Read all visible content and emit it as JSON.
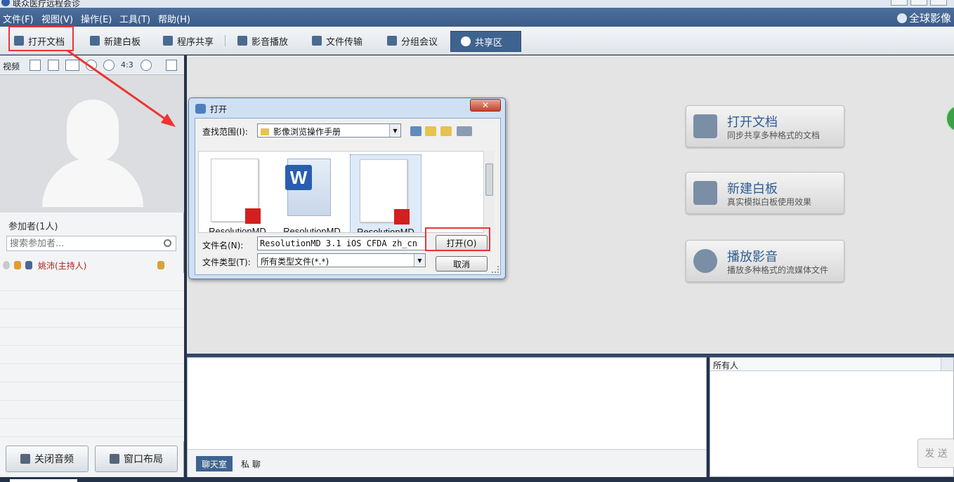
{
  "window": {
    "title": "联众医疗远程会诊"
  },
  "menu": {
    "items": [
      "文件(F)",
      "视图(V)",
      "操作(E)",
      "工具(T)",
      "帮助(H)"
    ],
    "brand": "全球影像"
  },
  "toolbar": {
    "open_doc": "打开文档",
    "whiteboard": "新建白板",
    "app_share": "程序共享",
    "media": "影音播放",
    "file_transfer": "文件传输",
    "group_meeting": "分组会议",
    "share_area": "共享区"
  },
  "video": {
    "label": "视频",
    "ratio": "4:3"
  },
  "participants": {
    "title": "参加者(1人)",
    "search_placeholder": "搜索参加者...",
    "list": [
      {
        "name": "姚沛(主持人)"
      }
    ]
  },
  "left_buttons": {
    "audio": "关闭音频",
    "layout": "窗口布局"
  },
  "share_cards": [
    {
      "title": "打开文档",
      "subtitle": "同步共享多种格式的文档"
    },
    {
      "title": "新建白板",
      "subtitle": "真实模拟白板使用效果"
    },
    {
      "title": "播放影音",
      "subtitle": "播放多种格式的流媒体文件"
    }
  ],
  "dialog": {
    "title": "打开",
    "look_in_label": "查找范围(I):",
    "look_in_value": "影像浏览操作手册",
    "files": [
      {
        "name": "ResolutionMD",
        "type": "pdf"
      },
      {
        "name": "ResolutionMD",
        "type": "word"
      },
      {
        "name": "ResolutionMD",
        "type": "pdf",
        "selected": true
      }
    ],
    "filename_label": "文件名(N):",
    "filename_value": "ResolutionMD 3.1 iOS CFDA zh_cn",
    "filetype_label": "文件类型(T):",
    "filetype_value": "所有类型文件(*.*)",
    "open_button": "打开(O)",
    "cancel_button": "取消"
  },
  "chat": {
    "tab_room": "聊天室",
    "tab_private": "私 聊",
    "recipient": "所有人",
    "send": "发 送"
  },
  "colors": {
    "accent": "#3f638f",
    "annotation": "#ee3333"
  }
}
